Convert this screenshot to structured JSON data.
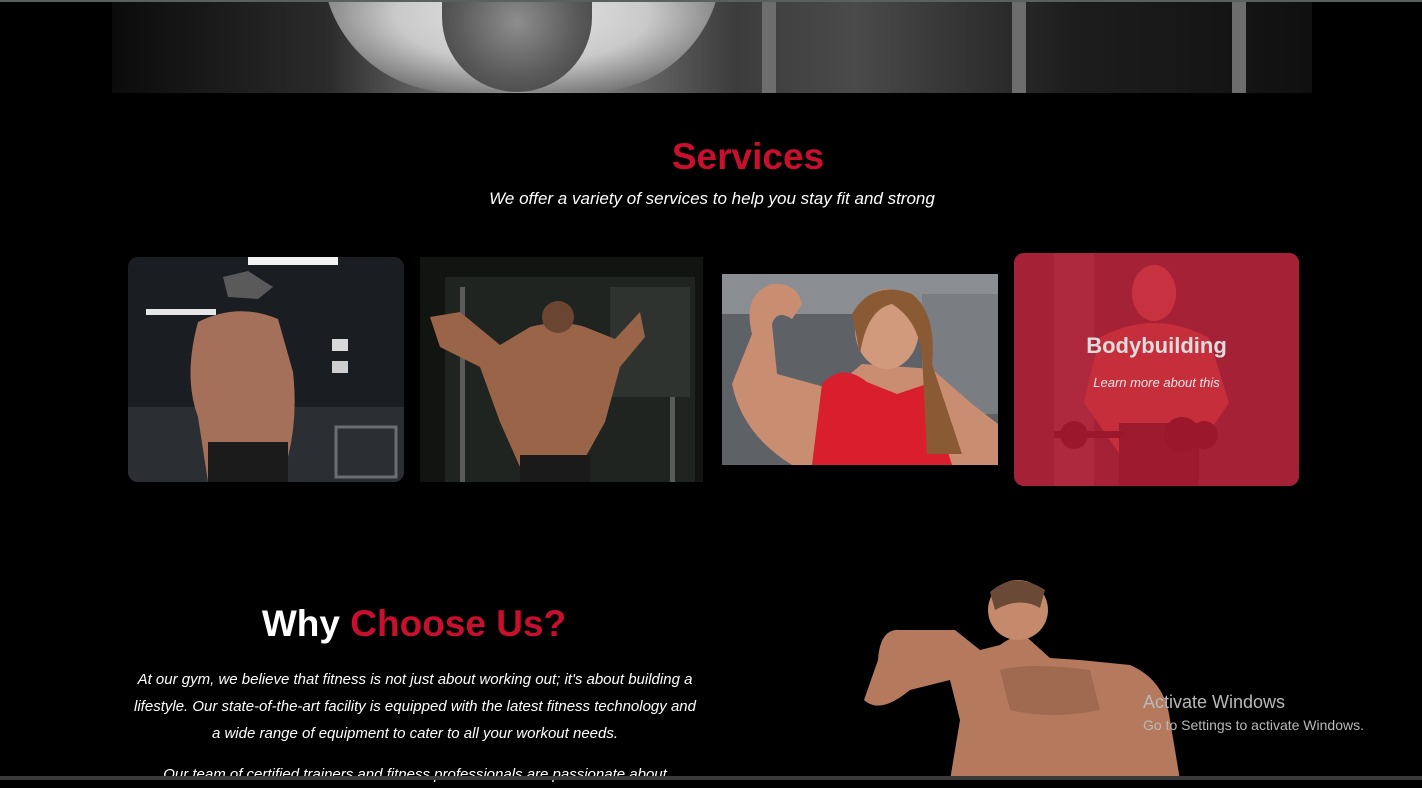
{
  "services": {
    "title": "Services",
    "subtitle": "We offer a variety of services to help you stay fit and strong",
    "cards": [
      {
        "image": "shirtless-man-cap-gym-photo"
      },
      {
        "image": "bodybuilder-back-pose-photo"
      },
      {
        "image": "woman-flexing-biceps-photo"
      },
      {
        "image": "bodybuilder-dumbbells-photo",
        "title": "Bodybuilding",
        "link": "Learn more about this"
      }
    ]
  },
  "why": {
    "title_part1": "Why",
    "title_part2": "Choose Us?",
    "paragraph1": "At our gym, we believe that fitness is not just about working out; it's about building a lifestyle. Our state-of-the-art facility is equipped with the latest fitness technology and a wide range of equipment to cater to all your workout needs.",
    "paragraph2": "Our team of certified trainers and fitness professionals are passionate about"
  },
  "watermark": {
    "line1": "Activate Windows",
    "line2": "Go to Settings to activate Windows."
  },
  "colors": {
    "accent": "#c8102e",
    "background": "#000000"
  }
}
